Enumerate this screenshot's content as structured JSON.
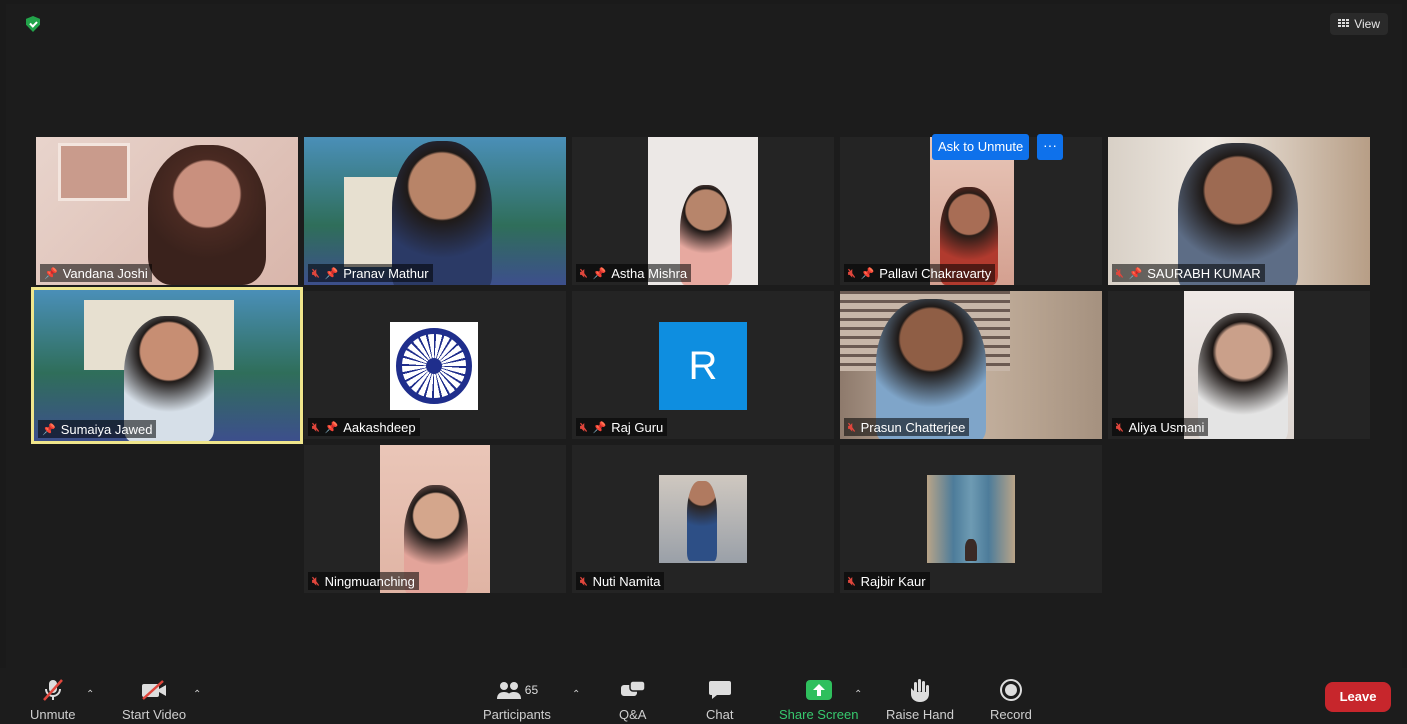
{
  "header": {
    "view_label": "View",
    "shield_icon": "shield-check-icon"
  },
  "spotlight_controls": {
    "ask_to_unmute": "Ask to Unmute",
    "more": "···"
  },
  "tiles": [
    {
      "name": "Vandana Joshi"
    },
    {
      "name": "Pranav Mathur"
    },
    {
      "name": "Astha Mishra"
    },
    {
      "name": "Pallavi Chakravarty"
    },
    {
      "name": "SAURABH KUMAR"
    },
    {
      "name": "Sumaiya Jawed"
    },
    {
      "name": "Aakashdeep"
    },
    {
      "name": "Raj Guru",
      "avatar_letter": "R"
    },
    {
      "name": "Prasun Chatterjee"
    },
    {
      "name": "Aliya Usmani"
    },
    {
      "name": "Ningmuanching"
    },
    {
      "name": "Nuti Namita"
    },
    {
      "name": "Rajbir Kaur"
    }
  ],
  "toolbar": {
    "unmute": "Unmute",
    "start_video": "Start Video",
    "participants": "Participants",
    "participants_count": "65",
    "qa": "Q&A",
    "chat": "Chat",
    "share_screen": "Share Screen",
    "raise_hand": "Raise Hand",
    "record": "Record",
    "leave": "Leave"
  },
  "colors": {
    "accent_blue": "#0e71eb",
    "share_green": "#37c96e",
    "leave_red": "#c7262c",
    "active_speaker": "#f0e68c"
  }
}
